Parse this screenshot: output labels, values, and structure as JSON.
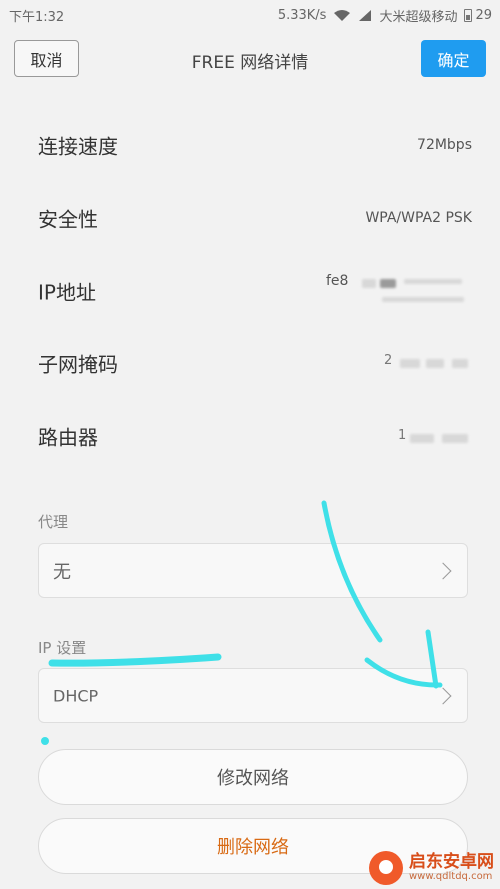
{
  "status_bar": {
    "time": "下午1:32",
    "speed": "5.33K/s",
    "carrier": "大米超级移动",
    "battery": "29"
  },
  "header": {
    "cancel_label": "取消",
    "title": "FREE  网络详情",
    "confirm_label": "确定"
  },
  "info": [
    {
      "label": "连接速度",
      "value": "72Mbps"
    },
    {
      "label": "安全性",
      "value": "WPA/WPA2 PSK"
    },
    {
      "label": "IP地址",
      "value": "fe8"
    },
    {
      "label": "子网掩码",
      "value": "2"
    },
    {
      "label": "路由器",
      "value": "1"
    }
  ],
  "proxy": {
    "section_label": "代理",
    "value": "无"
  },
  "ip_settings": {
    "section_label": "IP 设置",
    "value": "DHCP"
  },
  "actions": {
    "modify_label": "修改网络",
    "delete_label": "删除网络"
  },
  "watermark": {
    "title": "启东安卓网",
    "url": "www.qdltdq.com"
  },
  "colors": {
    "accent": "#1f9cf0",
    "danger": "#d86a14",
    "annotation": "#3fe0e8"
  }
}
